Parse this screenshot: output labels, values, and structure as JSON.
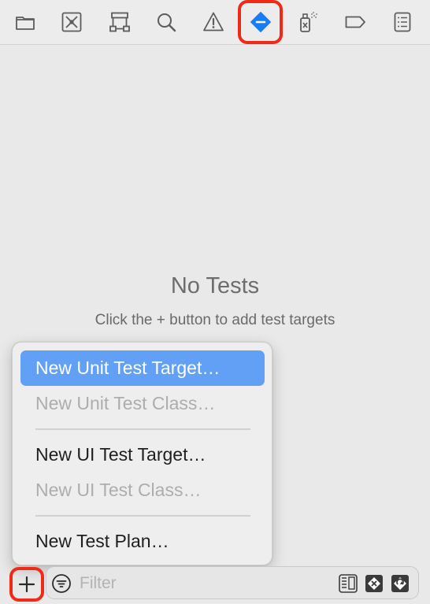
{
  "toolbar": {
    "icons": [
      "folder-icon",
      "source-control-icon",
      "symbol-hierarchy-icon",
      "search-icon",
      "warning-icon",
      "test-diamond-icon",
      "debug-spray-icon",
      "breakpoint-tag-icon",
      "report-list-icon"
    ],
    "selected_index": 5,
    "accent": "#1a7cf5",
    "highlight": "#ef2b17"
  },
  "empty_state": {
    "title": "No Tests",
    "subtitle": "Click the + button to add test targets"
  },
  "menu": {
    "items": [
      {
        "label": "New Unit Test Target…",
        "state": "selected"
      },
      {
        "label": "New Unit Test Class…",
        "state": "disabled"
      },
      {
        "label": "New UI Test Target…",
        "state": "enabled"
      },
      {
        "label": "New UI Test Class…",
        "state": "disabled"
      },
      {
        "label": "New Test Plan…",
        "state": "enabled"
      }
    ],
    "selected_color": "#62a0f6"
  },
  "bottom_bar": {
    "add_label": "+",
    "filter_placeholder": "Filter"
  }
}
